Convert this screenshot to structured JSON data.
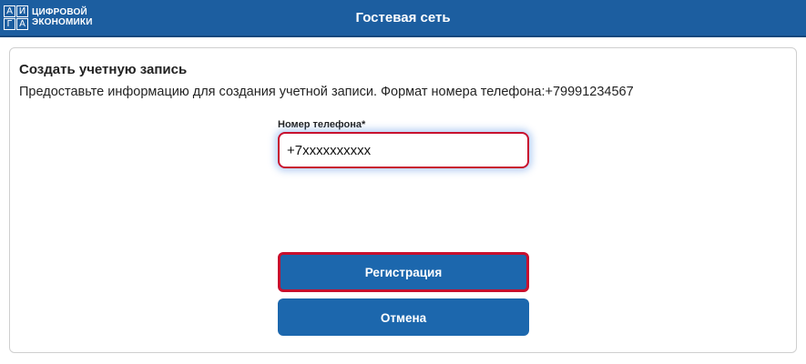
{
  "header": {
    "logo": {
      "letters": [
        "А",
        "И",
        "Г",
        "А"
      ],
      "line1": "ЦИФРОВОЙ",
      "line2": "ЭКОНОМИКИ"
    },
    "title": "Гостевая сеть",
    "background_color": "#1c5ea0"
  },
  "form": {
    "title": "Создать учетную запись",
    "description": "Предоставьте информацию для создания учетной записи. Формат номера телефона:+79991234567",
    "phone_label": "Номер телефона*",
    "phone_value": "+7xxxxxxxxxx",
    "register_label": "Регистрация",
    "cancel_label": "Отмена",
    "button_color": "#1c67ad",
    "highlight_color": "#c8102e"
  }
}
